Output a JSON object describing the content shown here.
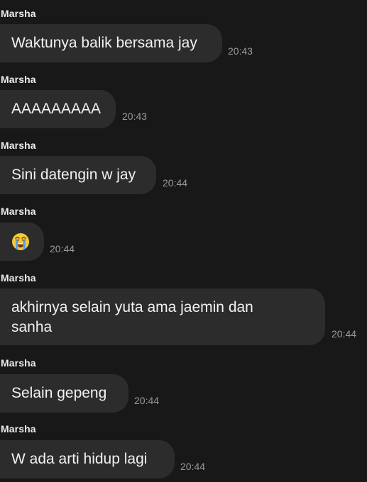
{
  "messages": [
    {
      "sender": "Marsha",
      "text": "Waktunya balik bersama jay",
      "time": "20:43"
    },
    {
      "sender": "Marsha",
      "text": "AAAAAAAAA",
      "time": "20:43"
    },
    {
      "sender": "Marsha",
      "text": "Sini datengin w jay",
      "time": "20:44"
    },
    {
      "sender": "Marsha",
      "emoji": "loudly-crying-face",
      "time": "20:44"
    },
    {
      "sender": "Marsha",
      "text_line1": "akhirnya selain yuta ama jaemin dan",
      "text_line2": "sanha",
      "time": "20:44"
    },
    {
      "sender": "Marsha",
      "text": "Selain gepeng",
      "time": "20:44"
    },
    {
      "sender": "Marsha",
      "text": "W ada arti hidup lagi",
      "time": "20:44"
    }
  ],
  "colors": {
    "background": "#181818",
    "bubble": "#2c2c2c",
    "text": "#f2f2f2",
    "time": "#9a9a9a",
    "emoji_yellow": "#f6c93a",
    "emoji_tears": "#4aa3f0"
  }
}
